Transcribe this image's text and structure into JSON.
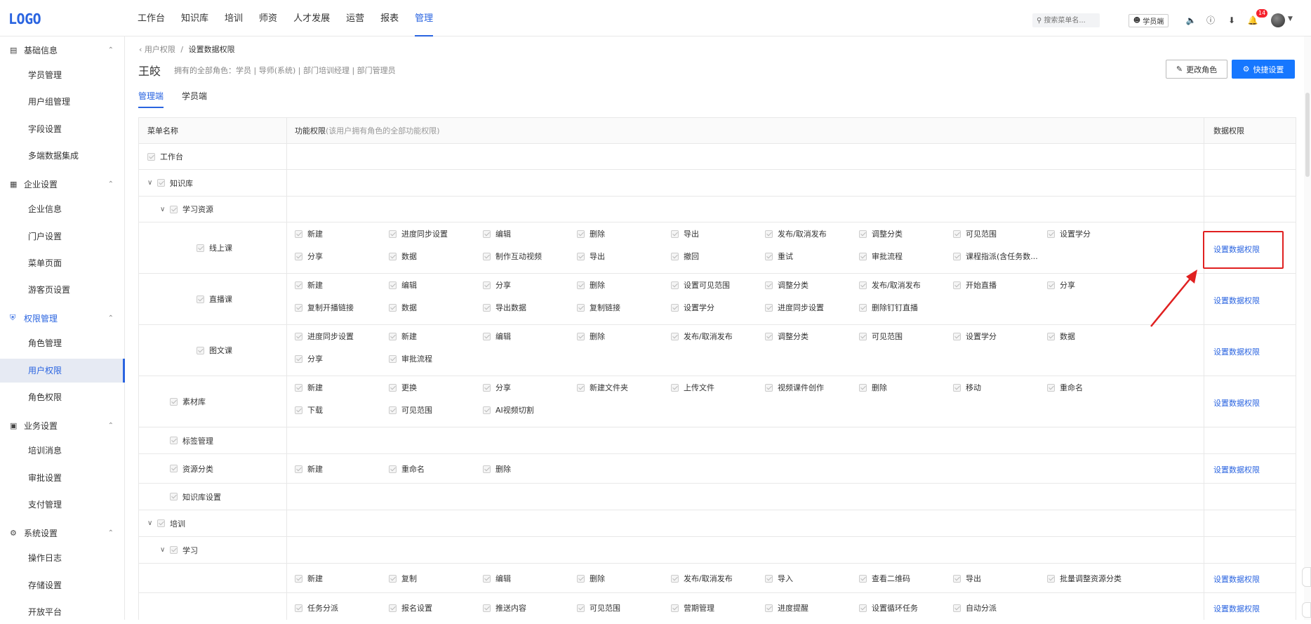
{
  "app": {
    "logo": "LOGO"
  },
  "nav": [
    "工作台",
    "知识库",
    "培训",
    "师资",
    "人才发展",
    "运营",
    "报表",
    "管理"
  ],
  "nav_active": "管理",
  "header": {
    "search_placeholder": "搜索菜单名...",
    "student_btn": "学员端",
    "notification_count": "14"
  },
  "sidebar": {
    "groups": [
      {
        "label": "基础信息",
        "icon": "book-icon",
        "items": [
          "学员管理",
          "用户组管理",
          "字段设置",
          "多端数据集成"
        ]
      },
      {
        "label": "企业设置",
        "icon": "building-icon",
        "items": [
          "企业信息",
          "门户设置",
          "菜单页面",
          "游客页设置"
        ]
      },
      {
        "label": "权限管理",
        "icon": "shield-icon",
        "items": [
          "角色管理",
          "用户权限",
          "角色权限"
        ]
      },
      {
        "label": "业务设置",
        "icon": "briefcase-icon",
        "items": [
          "培训消息",
          "审批设置",
          "支付管理"
        ]
      },
      {
        "label": "系统设置",
        "icon": "gear-icon",
        "items": [
          "操作日志",
          "存储设置",
          "开放平台"
        ]
      }
    ],
    "active_item": "用户权限"
  },
  "breadcrumb": {
    "back": "用户权限",
    "sep": "/",
    "current": "设置数据权限"
  },
  "user": {
    "name": "王皎",
    "roles": "拥有的全部角色：学员 | 导师(系统) | 部门培训经理 | 部门管理员"
  },
  "buttons": {
    "change_role": "更改角色",
    "quick_settings": "快捷设置"
  },
  "tabs": [
    "管理端",
    "学员端"
  ],
  "table": {
    "headers": {
      "menu": "菜单名称",
      "func": "功能权限",
      "func_sub": "(该用户拥有角色的全部功能权限)",
      "data": "数据权限"
    },
    "data_link": "设置数据权限",
    "rows": [
      {
        "name": "工作台",
        "indent": 0,
        "arrow": false,
        "perms": [],
        "link": false
      },
      {
        "name": "知识库",
        "indent": 0,
        "arrow": true,
        "perms": [],
        "link": false
      },
      {
        "name": "学习资源",
        "indent": 1,
        "arrow": true,
        "perms": [],
        "link": false
      },
      {
        "name": "线上课",
        "indent": 2,
        "arrow": false,
        "perms": [
          "新建",
          "进度同步设置",
          "编辑",
          "删除",
          "导出",
          "发布/取消发布",
          "调整分类",
          "可见范围",
          "设置学分",
          "分享",
          "数据",
          "制作互动视频",
          "导出",
          "撤回",
          "重试",
          "审批流程",
          "课程指派(含任务数..."
        ],
        "link": true
      },
      {
        "name": "直播课",
        "indent": 2,
        "arrow": false,
        "perms": [
          "新建",
          "编辑",
          "分享",
          "删除",
          "设置可见范围",
          "调整分类",
          "发布/取消发布",
          "开始直播",
          "分享",
          "复制开播链接",
          "数据",
          "导出数据",
          "复制链接",
          "设置学分",
          "进度同步设置",
          "删除钉钉直播"
        ],
        "link": true
      },
      {
        "name": "图文课",
        "indent": 2,
        "arrow": false,
        "perms": [
          "进度同步设置",
          "新建",
          "编辑",
          "删除",
          "发布/取消发布",
          "调整分类",
          "可见范围",
          "设置学分",
          "数据",
          "分享",
          "审批流程"
        ],
        "link": true
      },
      {
        "name": "素材库",
        "indent": 1,
        "arrow": false,
        "perms": [
          "新建",
          "更换",
          "分享",
          "新建文件夹",
          "上传文件",
          "视频课件创作",
          "删除",
          "移动",
          "重命名",
          "下载",
          "可见范围",
          "AI视频切割"
        ],
        "link": true
      },
      {
        "name": "标签管理",
        "indent": 1,
        "arrow": false,
        "perms": [],
        "link": false
      },
      {
        "name": "资源分类",
        "indent": 1,
        "arrow": false,
        "perms": [
          "新建",
          "重命名",
          "删除"
        ],
        "link": true
      },
      {
        "name": "知识库设置",
        "indent": 1,
        "arrow": false,
        "perms": [],
        "link": false
      },
      {
        "name": "培训",
        "indent": 0,
        "arrow": true,
        "perms": [],
        "link": false
      },
      {
        "name": "学习",
        "indent": 1,
        "arrow": true,
        "perms": [],
        "link": false
      },
      {
        "name": "",
        "indent": 2,
        "arrow": false,
        "perms": [
          "新建",
          "复制",
          "编辑",
          "删除",
          "发布/取消发布",
          "导入",
          "查看二维码",
          "导出",
          "批量调整资源分类"
        ],
        "link": true
      },
      {
        "name": "",
        "indent": 2,
        "arrow": false,
        "perms": [
          "任务分派",
          "报名设置",
          "推送内容",
          "可见范围",
          "营期管理",
          "进度提醒",
          "设置循环任务",
          "自动分派"
        ],
        "link": true
      }
    ]
  },
  "colors": {
    "accent": "#2a64e0",
    "primary_btn": "#1677ff",
    "highlight": "#e02020"
  }
}
